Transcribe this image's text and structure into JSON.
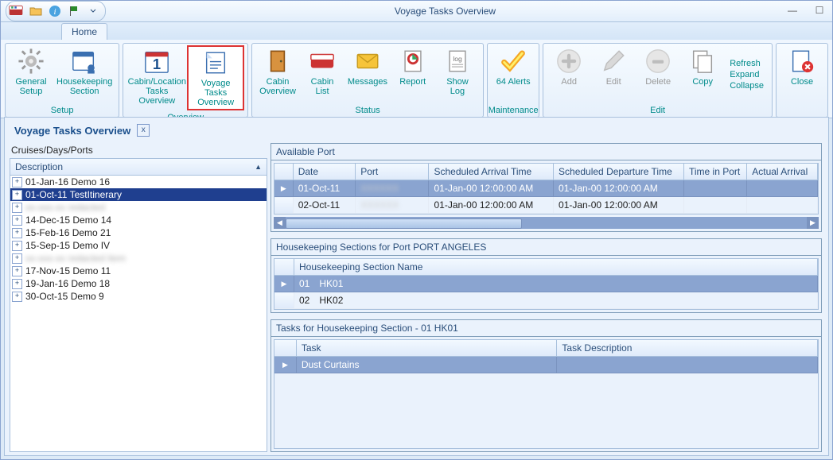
{
  "window": {
    "title": "Voyage Tasks Overview"
  },
  "win_buttons": {
    "min": "—",
    "max": "☐",
    "close": "✕"
  },
  "tabs": {
    "home": "Home"
  },
  "ribbon": {
    "setup": {
      "label": "Setup",
      "general_setup": "General\nSetup",
      "housekeeping_section": "Housekeeping\nSection"
    },
    "overview": {
      "label": "Overview",
      "cabin_location": "Cabin/Location\nTasks Overview",
      "voyage_tasks": "Voyage Tasks\nOverview"
    },
    "status": {
      "label": "Status",
      "cabin_overview": "Cabin\nOverview",
      "cabin_list": "Cabin\nList",
      "messages": "Messages",
      "report": "Report",
      "show_log": "Show Log"
    },
    "maintenance": {
      "label": "Maintenance",
      "alerts": "64 Alerts"
    },
    "edit": {
      "label": "Edit",
      "add": "Add",
      "edit": "Edit",
      "delete": "Delete",
      "copy": "Copy",
      "refresh": "Refresh",
      "expand": "Expand",
      "collapse": "Collapse"
    },
    "close": {
      "label": "Close"
    }
  },
  "doc": {
    "title": "Voyage Tasks Overview",
    "close": "x"
  },
  "left": {
    "heading": "Cruises/Days/Ports",
    "col": "Description",
    "items": [
      {
        "label": "01-Jan-16 Demo 16",
        "blur": false
      },
      {
        "label": "01-Oct-11 TestItinerary",
        "blur": false,
        "selected": true
      },
      {
        "label": "xx-xxx-xx redacted",
        "blur": true
      },
      {
        "label": "14-Dec-15 Demo 14",
        "blur": false
      },
      {
        "label": "15-Feb-16 Demo 21",
        "blur": false
      },
      {
        "label": "15-Sep-15 Demo IV",
        "blur": false
      },
      {
        "label": "xx-xxx-xx redacted item",
        "blur": true
      },
      {
        "label": "17-Nov-15 Demo 11",
        "blur": false
      },
      {
        "label": "19-Jan-16 Demo 18",
        "blur": false
      },
      {
        "label": "30-Oct-15 Demo 9",
        "blur": false
      }
    ]
  },
  "available_port": {
    "title": "Available Port",
    "cols": [
      "Date",
      "Port",
      "Scheduled Arrival Time",
      "Scheduled Departure Time",
      "Time in Port",
      "Actual Arrival"
    ],
    "rows": [
      {
        "date": "01-Oct-11",
        "port": "",
        "sched_arr": "01-Jan-00 12:00:00 AM",
        "sched_dep": "01-Jan-00 12:00:00 AM",
        "time_in_port": "",
        "actual_arr": "",
        "selected": true,
        "port_blur": true
      },
      {
        "date": "02-Oct-11",
        "port": "",
        "sched_arr": "01-Jan-00 12:00:00 AM",
        "sched_dep": "01-Jan-00 12:00:00 AM",
        "time_in_port": "",
        "actual_arr": "",
        "port_blur": true
      }
    ]
  },
  "sections": {
    "title": "Housekeeping Sections for Port PORT ANGELES",
    "col": "Housekeeping Section Name",
    "rows": [
      {
        "code": "01",
        "name": "HK01",
        "selected": true
      },
      {
        "code": "02",
        "name": "HK02"
      }
    ]
  },
  "tasks": {
    "title": "Tasks for Housekeeping Section - 01    HK01",
    "cols": [
      "Task",
      "Task Description"
    ],
    "rows": [
      {
        "task": "Dust Curtains",
        "desc": "",
        "selected": true
      }
    ]
  }
}
